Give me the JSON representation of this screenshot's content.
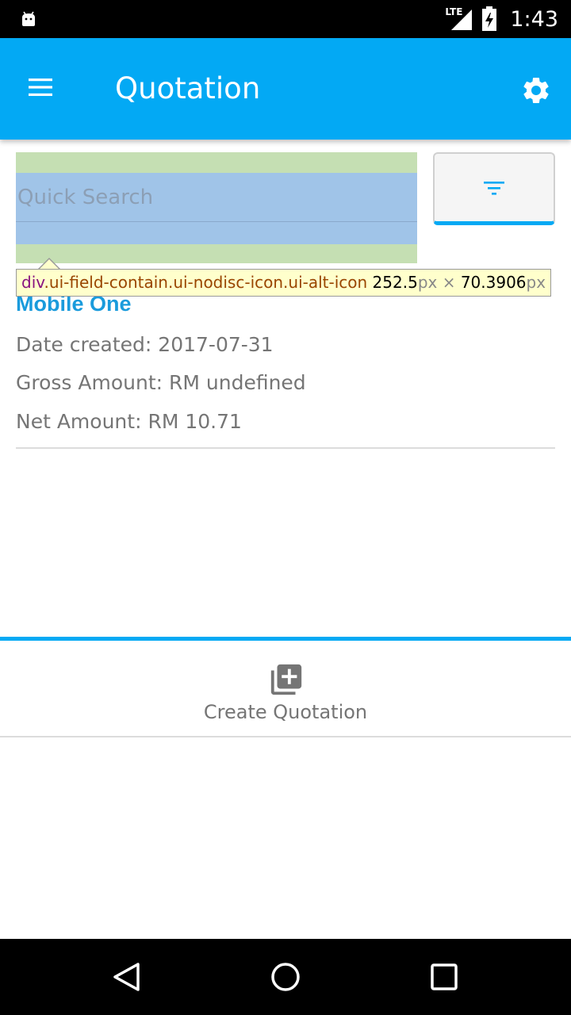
{
  "status_bar": {
    "time": "1:43",
    "network": "LTE",
    "icons": [
      "android-debug-icon",
      "signal-icon",
      "battery-icon"
    ]
  },
  "app_bar": {
    "title": "Quotation",
    "menu_icon": "menu-icon",
    "settings_icon": "gear-icon",
    "color": "#03a9f4"
  },
  "search": {
    "placeholder": "Quick Search",
    "filter_icon": "filter-icon"
  },
  "tooltip": {
    "selector_tag": "div",
    "selector_classes": ".ui-field-contain.ui-nodisc-icon.ui-alt-icon",
    "width_value": "252.5",
    "width_unit": "px",
    "separator": " × ",
    "height_value": "70.3906",
    "height_unit": "px"
  },
  "quotations": [
    {
      "title": "Mobile One",
      "date_created": "Date created: 2017-07-31",
      "gross_amount": "Gross Amount: RM undefined",
      "net_amount": "Net Amount: RM 10.71"
    }
  ],
  "create_button": {
    "label": "Create Quotation",
    "icon": "add-to-collection-icon"
  },
  "nav_bar": {
    "icons": [
      "back-icon",
      "home-icon",
      "recent-apps-icon"
    ]
  }
}
